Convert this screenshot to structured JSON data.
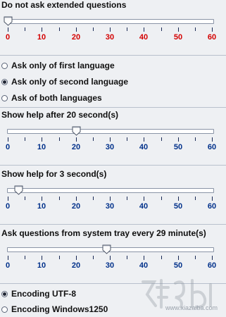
{
  "ext_questions": {
    "heading": "Do not ask extended questions",
    "value": 0,
    "max": 60,
    "labels": [
      "0",
      "10",
      "20",
      "30",
      "40",
      "50",
      "60"
    ],
    "label_color": "#d40000"
  },
  "language": {
    "options": [
      {
        "label": "Ask only of first language",
        "checked": false
      },
      {
        "label": "Ask only of second language",
        "checked": true
      },
      {
        "label": "Ask of both languages",
        "checked": false
      }
    ]
  },
  "help_after": {
    "heading": "Show help after 20 second(s)",
    "value": 20,
    "max": 60,
    "labels": [
      "0",
      "10",
      "20",
      "30",
      "40",
      "50",
      "60"
    ],
    "label_color": "#00308a"
  },
  "help_for": {
    "heading": "Show help for 3 second(s)",
    "value": 3,
    "max": 60,
    "labels": [
      "0",
      "10",
      "20",
      "30",
      "40",
      "50",
      "60"
    ],
    "label_color": "#00308a"
  },
  "tray_interval": {
    "heading": "Ask questions from system tray every 29 minute(s)",
    "value": 29,
    "max": 60,
    "labels": [
      "0",
      "10",
      "20",
      "30",
      "40",
      "50",
      "60"
    ],
    "label_color": "#00308a"
  },
  "encoding": {
    "options": [
      {
        "label": "Encoding UTF-8",
        "checked": true
      },
      {
        "label": "Encoding Windows1250",
        "checked": false
      }
    ]
  },
  "watermark": {
    "text": "www.xiazaiba.com"
  }
}
